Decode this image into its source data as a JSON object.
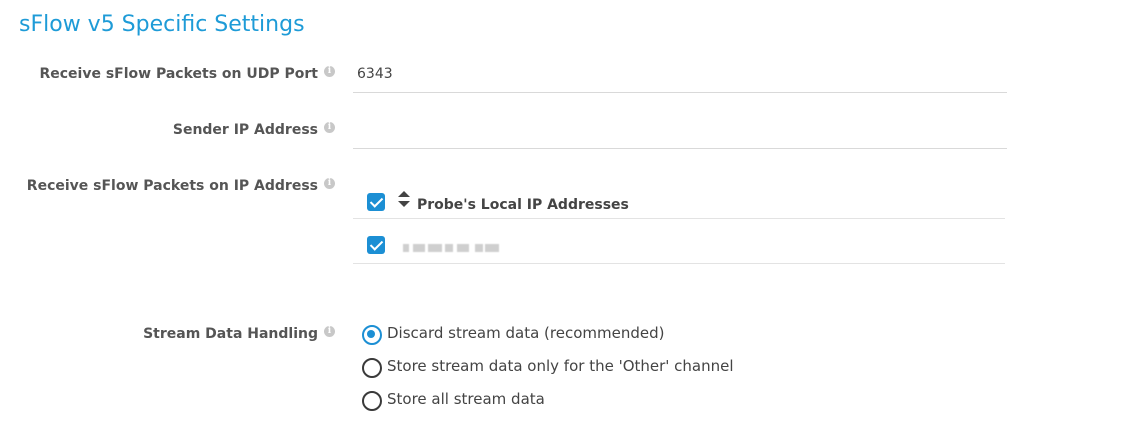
{
  "section": {
    "title": "sFlow v5 Specific Settings"
  },
  "udp_port": {
    "label": "Receive sFlow Packets on UDP Port",
    "value": "6343"
  },
  "sender_ip": {
    "label": "Sender IP Address",
    "value": ""
  },
  "receive_ip": {
    "label": "Receive sFlow Packets on IP Address",
    "header_label": "Probe's Local IP Addresses",
    "header_checked": true,
    "rows": [
      {
        "checked": true,
        "ip_redacted": true
      }
    ]
  },
  "stream_handling": {
    "label": "Stream Data Handling",
    "options": [
      {
        "label": "Discard stream data (recommended)",
        "selected": true
      },
      {
        "label": "Store stream data only for the 'Other' channel",
        "selected": false
      },
      {
        "label": "Store all stream data",
        "selected": false
      }
    ]
  },
  "colors": {
    "accent": "#1e9bd7",
    "checkbox": "#1c8fd4",
    "label": "#555555"
  },
  "icons": {
    "info": "info-icon",
    "sort": "sort-icon"
  }
}
